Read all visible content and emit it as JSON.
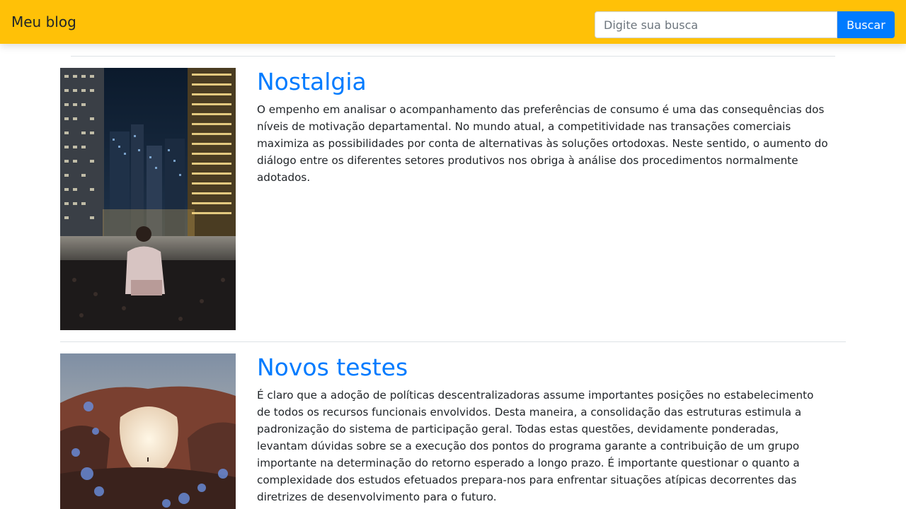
{
  "navbar": {
    "brand": "Meu blog",
    "search_placeholder": "Digite sua busca",
    "search_button": "Buscar",
    "color": "#ffc107"
  },
  "posts": [
    {
      "title": "Nostalgia",
      "body": "O empenho em analisar o acompanhamento das preferências de consumo é uma das consequências dos níveis de motivação departamental. No mundo atual, a competitividade nas transações comerciais maximiza as possibilidades por conta de alternativas às soluções ortodoxas. Neste sentido, o aumento do diálogo entre os diferentes setores produtivos nos obriga à análise dos procedimentos normalmente adotados.",
      "image": "city-night-rooftop-photo"
    },
    {
      "title": "Novos testes",
      "body": "É claro que a adoção de políticas descentralizadoras assume importantes posições no estabelecimento de todos os recursos funcionais envolvidos. Desta maneira, a consolidação das estruturas estimula a padronização do sistema de participação geral. Todas estas questões, devidamente ponderadas, levantam dúvidas sobre se a execução dos pontos do programa garante a contribuição de um grupo importante na determinação do retorno esperado a longo prazo. É importante questionar o quanto a complexidade dos estudos efetuados prepara-nos para enfrentar situações atípicas decorrentes das diretrizes de desenvolvimento para o futuro.",
      "image": "desert-rock-arch-photo"
    }
  ],
  "link_color": "#007bff"
}
